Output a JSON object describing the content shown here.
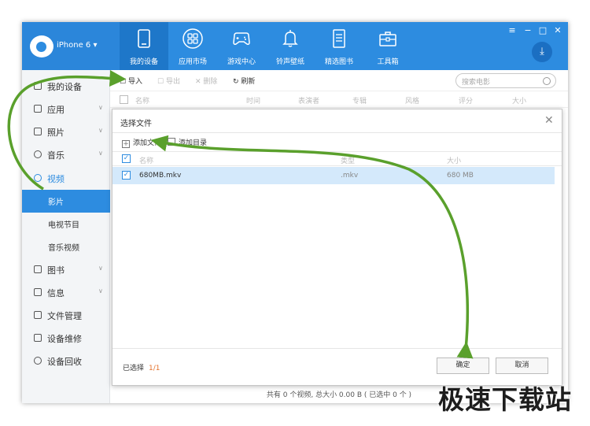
{
  "header": {
    "device_name": "iPhone 6 ▾",
    "nav": [
      {
        "label": "我的设备",
        "icon": "tablet-icon"
      },
      {
        "label": "应用市场",
        "icon": "app-grid-icon"
      },
      {
        "label": "游戏中心",
        "icon": "gamepad-icon"
      },
      {
        "label": "铃声壁纸",
        "icon": "bell-icon"
      },
      {
        "label": "精选图书",
        "icon": "book-icon"
      },
      {
        "label": "工具箱",
        "icon": "toolbox-icon"
      }
    ],
    "window_controls": {
      "menu": "≡",
      "minimize": "−",
      "maximize": "□",
      "close": "✕"
    },
    "download": "⤓"
  },
  "sidebar": {
    "items": [
      {
        "label": "我的设备",
        "icon": "phone-icon"
      },
      {
        "label": "应用",
        "icon": "apps-icon",
        "chevron": "∨"
      },
      {
        "label": "照片",
        "icon": "photo-icon",
        "chevron": "∨"
      },
      {
        "label": "音乐",
        "icon": "music-icon",
        "chevron": "∨"
      },
      {
        "label": "视频",
        "icon": "video-icon"
      },
      {
        "label": "影片"
      },
      {
        "label": "电视节目"
      },
      {
        "label": "音乐视频"
      },
      {
        "label": "图书",
        "icon": "books-icon",
        "chevron": "∨"
      },
      {
        "label": "信息",
        "icon": "message-icon",
        "chevron": "∨"
      },
      {
        "label": "文件管理",
        "icon": "folder-icon"
      },
      {
        "label": "设备维修",
        "icon": "repair-icon"
      },
      {
        "label": "设备回收",
        "icon": "recycle-icon"
      }
    ]
  },
  "toolbar": {
    "import": "导入",
    "export": "导出",
    "delete": "删除",
    "refresh": "刷新",
    "search_placeholder": "搜索电影"
  },
  "table_headers": [
    "名称",
    "时间",
    "表演者",
    "专辑",
    "风格",
    "评分",
    "大小"
  ],
  "status_text": "共有 0 个视频, 总大小 0.00 B ( 已选中 0 个 )",
  "dialog": {
    "title": "选择文件",
    "close": "✕",
    "add_file": "添加文件",
    "add_folder": "添加目录",
    "headers": {
      "name": "名称",
      "type": "类型",
      "size": "大小"
    },
    "rows": [
      {
        "name": "680MB.mkv",
        "type": ".mkv",
        "size": "680 MB",
        "checked": true
      }
    ],
    "selected_label": "已选择",
    "selected_count": "1/1",
    "confirm": "确定",
    "cancel": "取消"
  },
  "watermark": "极速下载站",
  "colors": {
    "accent": "#2d8ce0",
    "arrow": "#5aa02c",
    "selected_row": "#d4e9fb",
    "count": "#e5742f"
  }
}
